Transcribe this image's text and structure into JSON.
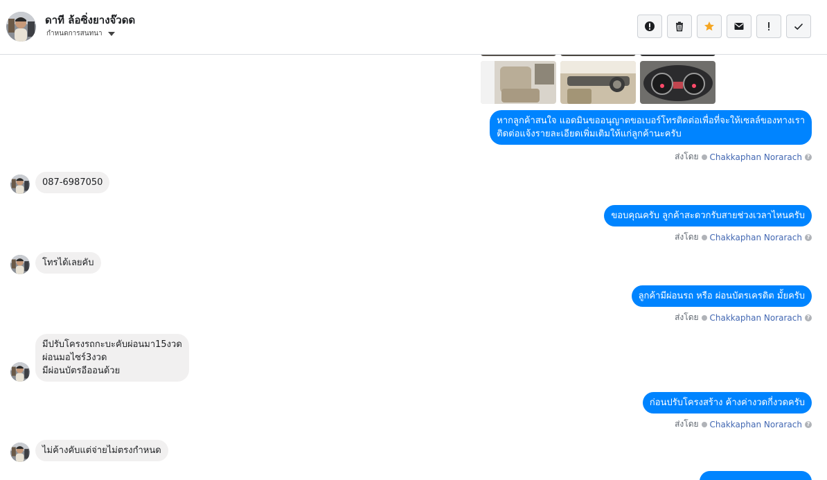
{
  "header": {
    "name": "ดาที ล้อซิ่งยางจ๊วดด",
    "sub_label": "กำหนดการสนทนา"
  },
  "toolbar": {
    "buttons": [
      {
        "icon": "alert-circle-icon",
        "name": "report-button"
      },
      {
        "icon": "trash-icon",
        "name": "delete-button"
      },
      {
        "icon": "star-icon",
        "name": "star-button",
        "color": "#f5a623"
      },
      {
        "icon": "envelope-icon",
        "name": "mark-unread-button"
      },
      {
        "icon": "exclamation-icon",
        "name": "spam-button"
      },
      {
        "icon": "checkmark-icon",
        "name": "done-button"
      }
    ]
  },
  "messages": {
    "out1_line1": "หากลูกค้าสนใจ แอดมินขออนุญาตขอเบอร์โทรติดต่อเพื่อที่จะให้เซลล์ของทางเรา",
    "out1_line2": "ติดต่อแจ้งรายละเอียดเพิ่มเติมให้แก่ลูกค้านะครับ",
    "in1": "087-6987050",
    "out2": "ขอบคุณครับ ลูกค้าสะดวกรับสายช่วงเวลาไหนครับ",
    "in2": "โทรได้เลยคับ",
    "out3": "ลูกค้ามีผ่อนรถ หรือ ผ่อนบัตรเครดิต มั้ยครับ",
    "in3_line1": "มีปรับโครงรถกะบะคับผ่อนมา15งวด",
    "in3_line2": "ผ่อนมอไซร์3งวด",
    "in3_line3": "มีผ่อนบัตรอีออนด้วย",
    "out4": "ก่อนปรับโครงสร้าง ค้างค่างวดกี่งวดครับ",
    "in4": "ไม่ค้างคับแต่จ่ายไม่ตรงกำหนด"
  },
  "sent_by": {
    "prefix": "ส่งโดย",
    "sender": "Chakkaphan Norarach"
  },
  "colors": {
    "outgoing_bubble": "#0084ff",
    "incoming_bubble": "#f1f0f0",
    "sender_link": "#4267b2"
  }
}
